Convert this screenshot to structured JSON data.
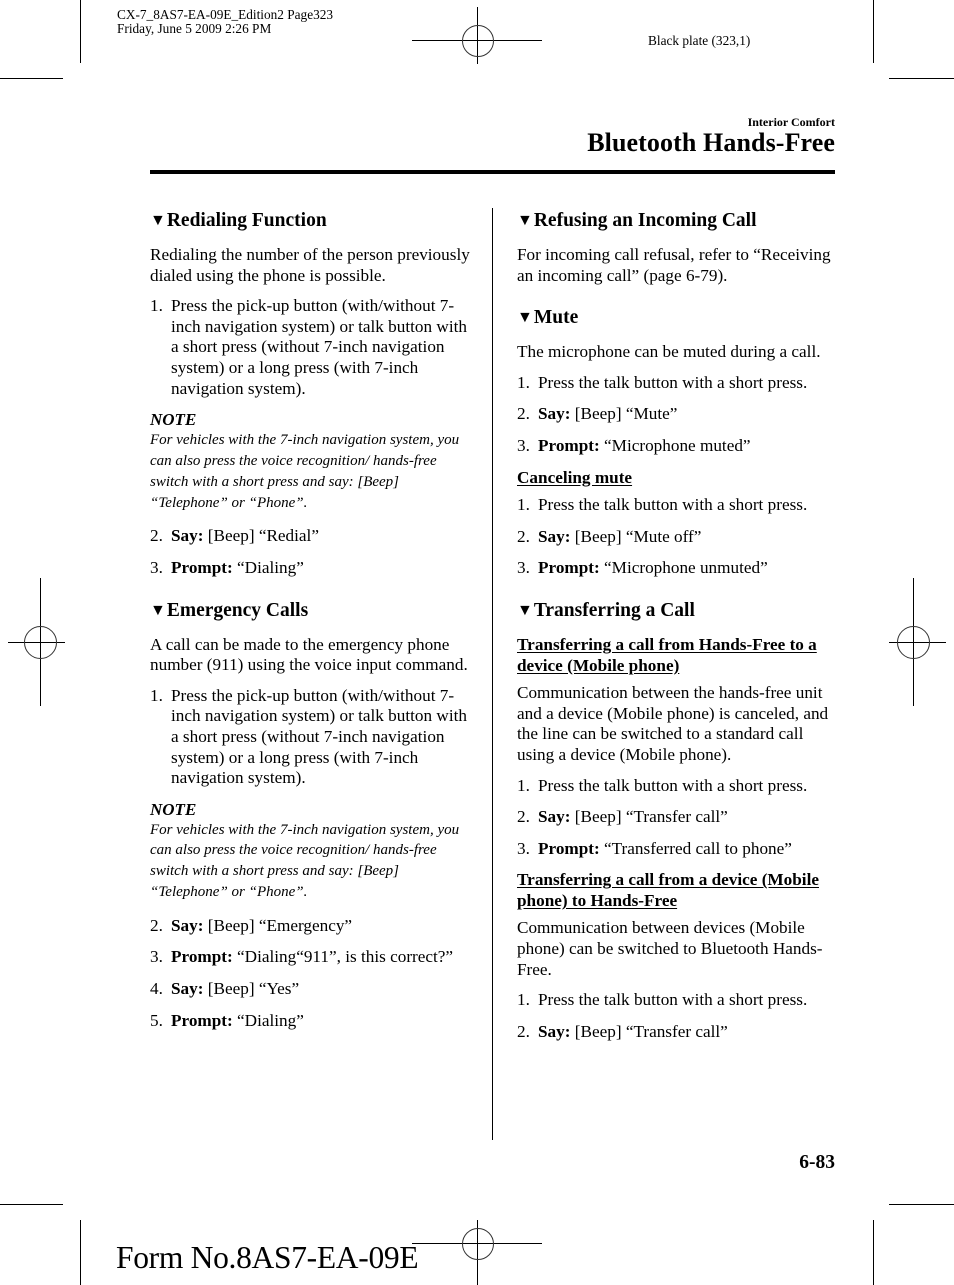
{
  "slug": {
    "line1": "CX-7_8AS7-EA-09E_Edition2 Page323",
    "line2": "Friday, June 5 2009 2:26 PM",
    "plate": "Black plate (323,1)"
  },
  "header": {
    "section": "Interior Comfort",
    "title": "Bluetooth Hands-Free"
  },
  "left": {
    "redialing": {
      "marker": "▼",
      "heading": "Redialing Function",
      "intro": "Redialing the number of the person previously dialed using the phone is possible.",
      "step1": {
        "num": "1.",
        "text": "Press the pick-up button (with/without 7-inch navigation system) or talk button with a short press (without 7-inch navigation system) or a long press (with 7-inch navigation system)."
      },
      "note_label": "NOTE",
      "note_text": "For vehicles with the 7-inch navigation system, you can also press the voice recognition/ hands-free switch with a short press and say: [Beep] “Telephone” or “Phone”.",
      "step2": {
        "num": "2.",
        "label": "Say:",
        "text": " [Beep] “Redial”"
      },
      "step3": {
        "num": "3.",
        "label": "Prompt:",
        "text": " “Dialing”"
      }
    },
    "emergency": {
      "marker": "▼",
      "heading": "Emergency Calls",
      "intro": "A call can be made to the emergency phone number (911) using the voice input command.",
      "step1": {
        "num": "1.",
        "text": "Press the pick-up button (with/without 7-inch navigation system) or talk button with a short press (without 7-inch navigation system) or a long press (with 7-inch navigation system)."
      },
      "note_label": "NOTE",
      "note_text": "For vehicles with the 7-inch navigation system, you can also press the voice recognition/ hands-free switch with a short press and say: [Beep] “Telephone” or “Phone”.",
      "step2": {
        "num": "2.",
        "label": "Say:",
        "text": " [Beep] “Emergency”"
      },
      "step3": {
        "num": "3.",
        "label": "Prompt:",
        "text": " “Dialing“911”, is this correct?”"
      },
      "step4": {
        "num": "4.",
        "label": "Say:",
        "text": " [Beep] “Yes”"
      },
      "step5": {
        "num": "5.",
        "label": "Prompt:",
        "text": " “Dialing”"
      }
    }
  },
  "right": {
    "refusing": {
      "marker": "▼",
      "heading": "Refusing an Incoming Call",
      "text": "For incoming call refusal, refer to “Receiving an incoming call” (page 6-79)."
    },
    "mute": {
      "marker": "▼",
      "heading": "Mute",
      "intro": "The microphone can be muted during a call.",
      "step1": {
        "num": "1.",
        "text": "Press the talk button with a short press."
      },
      "step2": {
        "num": "2.",
        "label": "Say:",
        "text": " [Beep] “Mute”"
      },
      "step3": {
        "num": "3.",
        "label": "Prompt:",
        "text": " “Microphone muted”"
      },
      "cancel_heading": "Canceling mute",
      "cstep1": {
        "num": "1.",
        "text": "Press the talk button with a short press."
      },
      "cstep2": {
        "num": "2.",
        "label": "Say:",
        "text": " [Beep] “Mute off”"
      },
      "cstep3": {
        "num": "3.",
        "label": "Prompt:",
        "text": " “Microphone unmuted”"
      }
    },
    "transfer": {
      "marker": "▼",
      "heading": "Transferring a Call",
      "sub1": "Transferring a call from Hands-Free to a device (Mobile phone)",
      "sub1_text": "Communication between the hands-free unit and a device (Mobile phone) is canceled, and the line can be switched to a standard call using a device (Mobile phone).",
      "s1step1": {
        "num": "1.",
        "text": "Press the talk button with a short press."
      },
      "s1step2": {
        "num": "2.",
        "label": "Say:",
        "text": " [Beep] “Transfer call”"
      },
      "s1step3": {
        "num": "3.",
        "label": "Prompt:",
        "text": " “Transferred call to phone”"
      },
      "sub2": "Transferring a call from a device (Mobile phone) to Hands-Free",
      "sub2_text": "Communication between devices (Mobile phone) can be switched to Bluetooth Hands-Free.",
      "s2step1": {
        "num": "1.",
        "text": "Press the talk button with a short press."
      },
      "s2step2": {
        "num": "2.",
        "label": "Say:",
        "text": " [Beep] “Transfer call”"
      }
    }
  },
  "footer": {
    "page_number": "6-83",
    "form_number": "Form No.8AS7-EA-09E"
  }
}
